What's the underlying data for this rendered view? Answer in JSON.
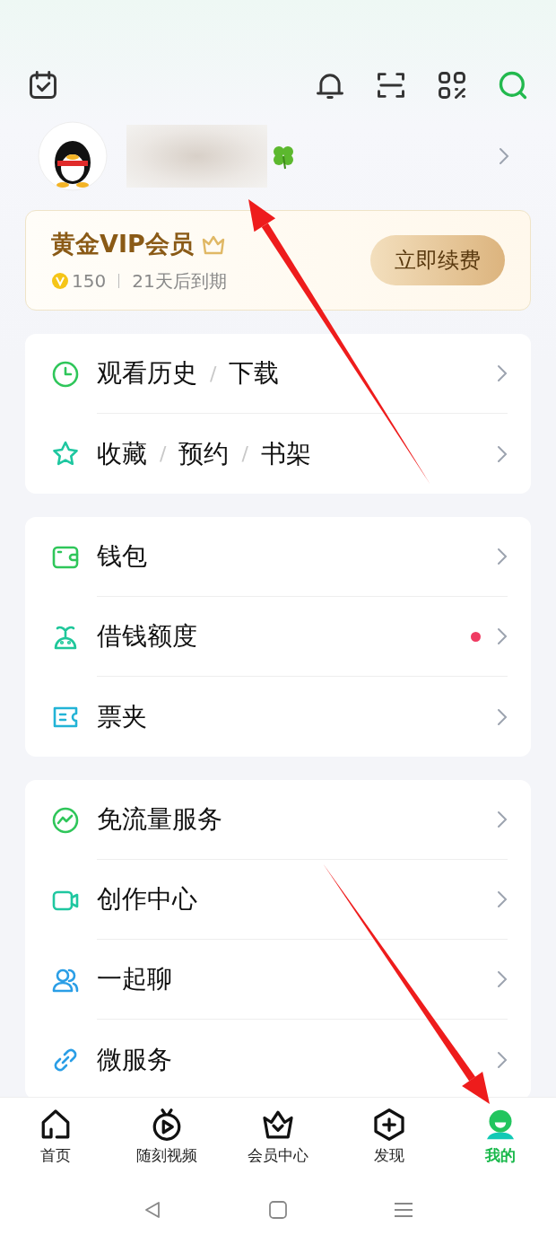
{
  "vip": {
    "title": "黄金VIP会员",
    "points": "150",
    "expiry": "21天后到期",
    "button": "立即续费"
  },
  "sections": [
    {
      "rows": [
        {
          "kind": "clock",
          "dot": false,
          "parts": [
            {
              "kind": "label",
              "text": "观看历史"
            },
            {
              "kind": "separator",
              "text": "/"
            },
            {
              "kind": "label",
              "text": "下载"
            }
          ]
        },
        {
          "kind": "star",
          "dot": false,
          "parts": [
            {
              "kind": "label",
              "text": "收藏"
            },
            {
              "kind": "separator",
              "text": "/"
            },
            {
              "kind": "label",
              "text": "预约"
            },
            {
              "kind": "separator",
              "text": "/"
            },
            {
              "kind": "label",
              "text": "书架"
            }
          ]
        }
      ]
    },
    {
      "rows": [
        {
          "kind": "wallet",
          "dot": false,
          "parts": [
            {
              "kind": "label",
              "text": "钱包"
            }
          ]
        },
        {
          "kind": "sprout",
          "dot": true,
          "parts": [
            {
              "kind": "label",
              "text": "借钱额度"
            }
          ]
        },
        {
          "kind": "ticket",
          "dot": false,
          "parts": [
            {
              "kind": "label",
              "text": "票夹"
            }
          ]
        }
      ]
    },
    {
      "rows": [
        {
          "kind": "trend",
          "dot": false,
          "parts": [
            {
              "kind": "label",
              "text": "免流量服务"
            }
          ]
        },
        {
          "kind": "camera",
          "dot": false,
          "parts": [
            {
              "kind": "label",
              "text": "创作中心"
            }
          ]
        },
        {
          "kind": "people",
          "dot": false,
          "parts": [
            {
              "kind": "label",
              "text": "一起聊"
            }
          ]
        },
        {
          "kind": "link",
          "dot": false,
          "parts": [
            {
              "kind": "label",
              "text": "微服务"
            }
          ]
        }
      ]
    }
  ],
  "tabs": [
    {
      "kind": "home",
      "label": "首页",
      "selected": false
    },
    {
      "kind": "video",
      "label": "随刻视频",
      "selected": false
    },
    {
      "kind": "vip",
      "label": "会员中心",
      "selected": false
    },
    {
      "kind": "discover",
      "label": "发现",
      "selected": false
    },
    {
      "kind": "me",
      "label": "我的",
      "selected": true
    }
  ],
  "annotations": [
    {
      "kind": "arrow"
    },
    {
      "kind": "arrow"
    }
  ]
}
